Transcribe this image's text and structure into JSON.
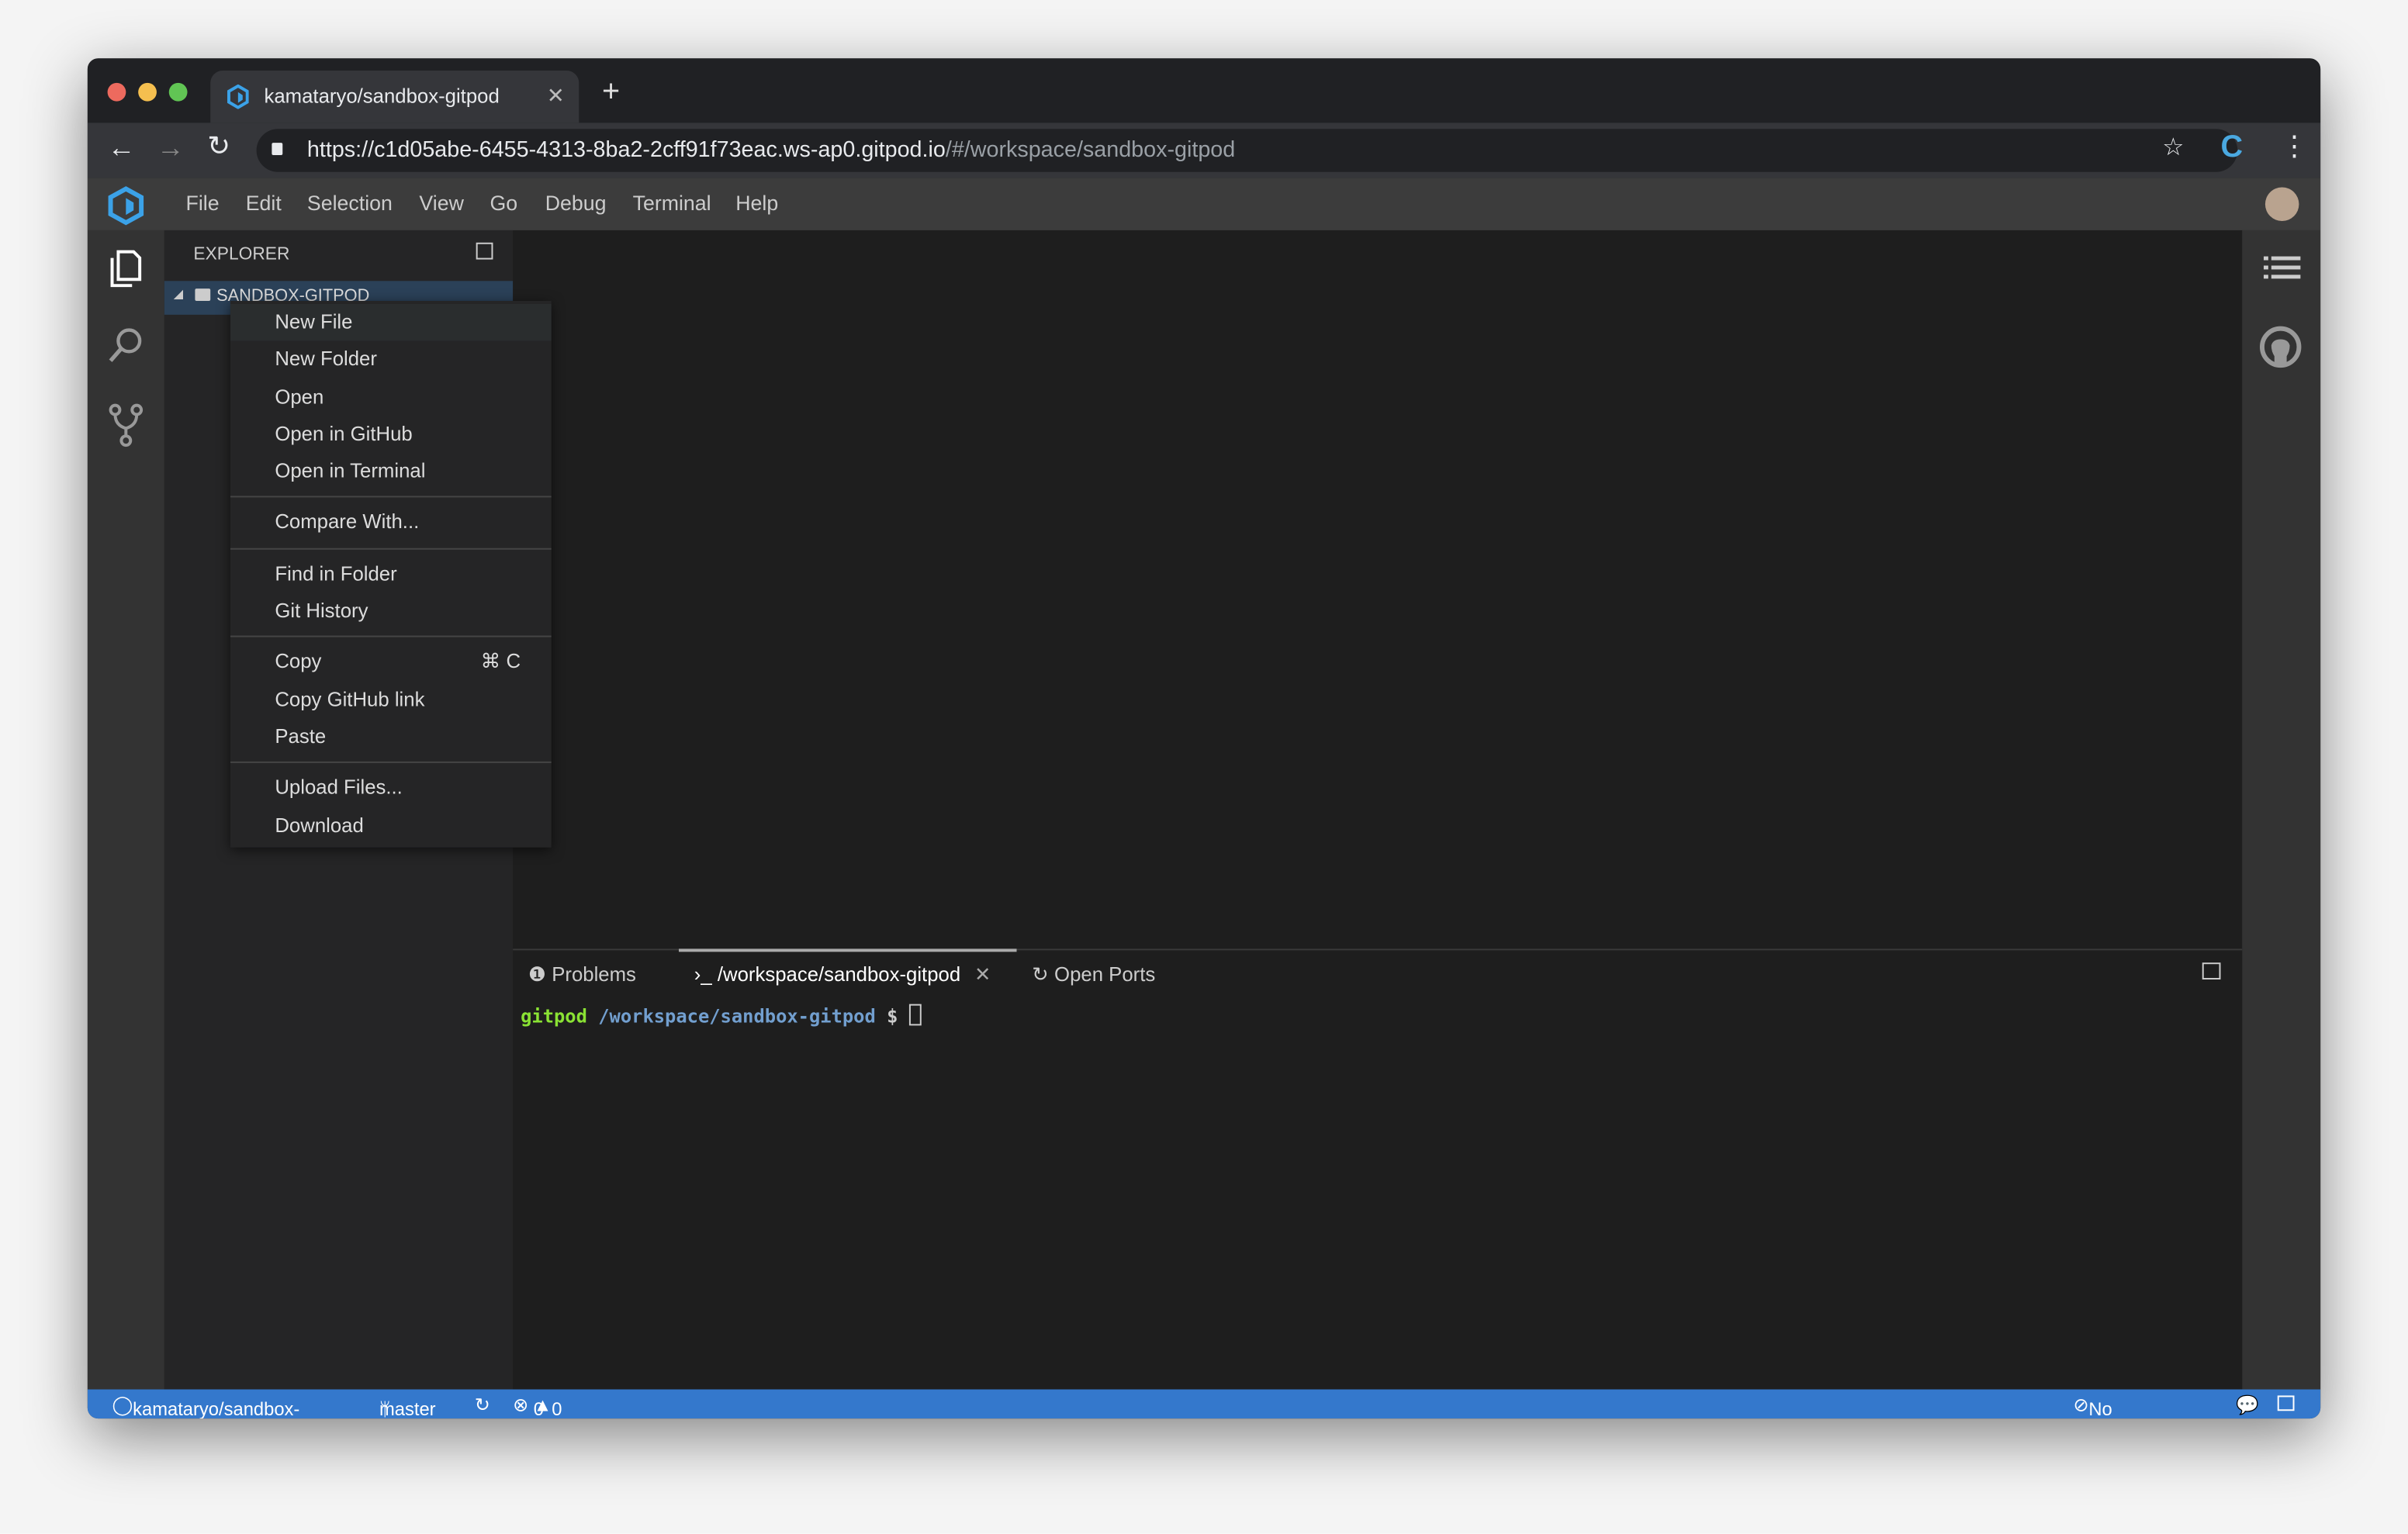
{
  "browser": {
    "tab_title": "kamataryo/sandbox-gitpod",
    "url_main": "https://c1d05abe-6455-4313-8ba2-2cff91f73eac.ws-ap0.gitpod.io",
    "url_hash": "/#/workspace/sandbox-gitpod",
    "traffic_colors": [
      "#ed6a5e",
      "#f5bf4f",
      "#61c554"
    ]
  },
  "menubar": {
    "items": [
      "File",
      "Edit",
      "Selection",
      "View",
      "Go",
      "Debug",
      "Terminal",
      "Help"
    ]
  },
  "explorer": {
    "title": "EXPLORER",
    "root_folder": "SANDBOX-GITPOD"
  },
  "context_menu": {
    "groups": [
      [
        {
          "label": "New File"
        },
        {
          "label": "New Folder"
        },
        {
          "label": "Open"
        },
        {
          "label": "Open in GitHub"
        },
        {
          "label": "Open in Terminal"
        }
      ],
      [
        {
          "label": "Compare With..."
        }
      ],
      [
        {
          "label": "Find in Folder"
        },
        {
          "label": "Git History"
        }
      ],
      [
        {
          "label": "Copy",
          "shortcut": "⌘ C"
        },
        {
          "label": "Copy GitHub link"
        },
        {
          "label": "Paste"
        }
      ],
      [
        {
          "label": "Upload Files..."
        },
        {
          "label": "Download"
        }
      ]
    ]
  },
  "panel": {
    "tabs": [
      {
        "label": "Problems",
        "icon": "info-icon"
      },
      {
        "label": "/workspace/sandbox-gitpod",
        "icon": "terminal-icon",
        "active": true
      },
      {
        "label": "Open Ports",
        "icon": "ports-icon"
      }
    ],
    "terminal": {
      "user": "gitpod",
      "cwd": "/workspace/sandbox-gitpod",
      "prompt": "$"
    }
  },
  "statusbar": {
    "repo": "kamataryo/sandbox-gitpod",
    "branch": "master",
    "errors": "0",
    "warnings": "0",
    "ports": "No open ports",
    "color": "#3478cc"
  }
}
